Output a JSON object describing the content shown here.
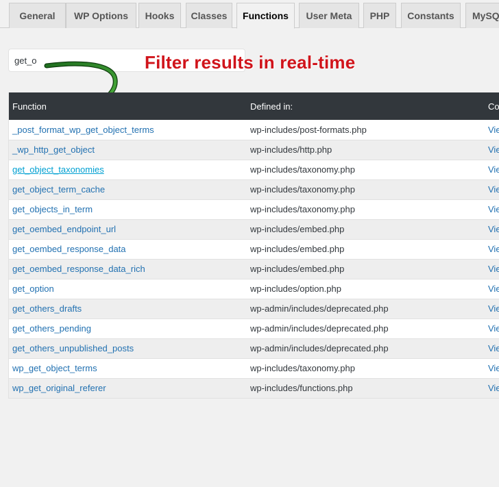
{
  "tabs": [
    {
      "label": "General"
    },
    {
      "label": "WP Options"
    },
    {
      "label": "Hooks"
    },
    {
      "label": "Classes"
    },
    {
      "label": "Functions"
    },
    {
      "label": "User Meta"
    },
    {
      "label": "PHP"
    },
    {
      "label": "Constants"
    },
    {
      "label": "MySQ"
    }
  ],
  "active_tab": "Functions",
  "search": {
    "value": "get_o"
  },
  "annotation": {
    "text": "Filter results in real-time"
  },
  "table": {
    "headers": [
      "Function",
      "Defined in:",
      "Co"
    ],
    "rows": [
      {
        "fn": "_post_format_wp_get_object_terms",
        "file": "wp-includes/post-formats.php",
        "code": "Vie"
      },
      {
        "fn": "_wp_http_get_object",
        "file": "wp-includes/http.php",
        "code": "Vie"
      },
      {
        "fn": "get_object_taxonomies",
        "file": "wp-includes/taxonomy.php",
        "code": "Vie"
      },
      {
        "fn": "get_object_term_cache",
        "file": "wp-includes/taxonomy.php",
        "code": "Vie"
      },
      {
        "fn": "get_objects_in_term",
        "file": "wp-includes/taxonomy.php",
        "code": "Vie"
      },
      {
        "fn": "get_oembed_endpoint_url",
        "file": "wp-includes/embed.php",
        "code": "Vie"
      },
      {
        "fn": "get_oembed_response_data",
        "file": "wp-includes/embed.php",
        "code": "Vie"
      },
      {
        "fn": "get_oembed_response_data_rich",
        "file": "wp-includes/embed.php",
        "code": "Vie"
      },
      {
        "fn": "get_option",
        "file": "wp-includes/option.php",
        "code": "Vie"
      },
      {
        "fn": "get_others_drafts",
        "file": "wp-admin/includes/deprecated.php",
        "code": "Vie"
      },
      {
        "fn": "get_others_pending",
        "file": "wp-admin/includes/deprecated.php",
        "code": "Vie"
      },
      {
        "fn": "get_others_unpublished_posts",
        "file": "wp-admin/includes/deprecated.php",
        "code": "Vie"
      },
      {
        "fn": "wp_get_object_terms",
        "file": "wp-includes/taxonomy.php",
        "code": "Vie"
      },
      {
        "fn": "wp_get_original_referer",
        "file": "wp-includes/functions.php",
        "code": "Vie"
      }
    ],
    "hovered_row": 2
  },
  "colors": {
    "header_bg": "#32373c",
    "link": "#2271b1",
    "link_hover": "#00a0d2",
    "annotation": "#d0141b",
    "arrow": "#2e8b2e"
  },
  "icons": {
    "arrow": "curved-arrow-icon"
  }
}
